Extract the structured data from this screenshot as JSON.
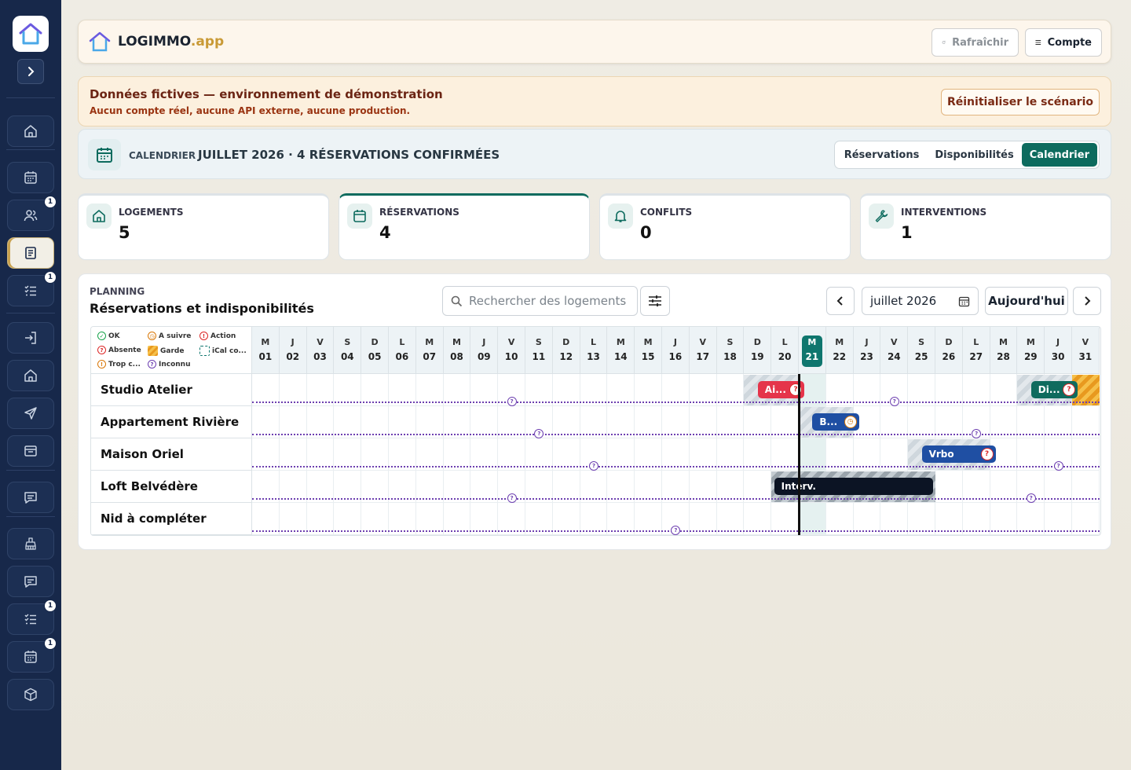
{
  "brand": {
    "name": "LOGIMMO",
    "suffix": ".app"
  },
  "topbar": {
    "refresh_label": "Rafraîchir",
    "account_label": "Compte"
  },
  "banner": {
    "title": "Données fictives — environnement de démonstration",
    "subtitle": "Aucun compte réel, aucune API externe, aucune production.",
    "reset_label": "Réinitialiser le scénario"
  },
  "calendar_bar": {
    "label": "CALENDRIER",
    "title": "JUILLET 2026 · 4 RÉSERVATIONS CONFIRMÉES",
    "tabs": [
      {
        "label": "Réservations",
        "active": false
      },
      {
        "label": "Disponibilités",
        "active": false
      },
      {
        "label": "Calendrier",
        "active": true
      }
    ]
  },
  "kpis": [
    {
      "label": "LOGEMENTS",
      "value": "5",
      "icon": "home-icon"
    },
    {
      "label": "RÉSERVATIONS",
      "value": "4",
      "icon": "calendar-icon"
    },
    {
      "label": "CONFLITS",
      "value": "0",
      "icon": "bell-icon"
    },
    {
      "label": "INTERVENTIONS",
      "value": "1",
      "icon": "wrench-icon"
    }
  ],
  "sidebar": {
    "items": [
      {
        "icon": "home-icon",
        "badge": ""
      },
      {
        "icon": "calendar-icon",
        "badge": ""
      },
      {
        "icon": "users-icon",
        "badge": "1"
      },
      {
        "icon": "document-icon",
        "badge": "",
        "active": true
      },
      {
        "icon": "checklist-icon",
        "badge": "1"
      },
      {
        "icon": "login-icon",
        "badge": ""
      },
      {
        "icon": "home-icon",
        "badge": ""
      },
      {
        "icon": "send-icon",
        "badge": ""
      },
      {
        "icon": "inbox-icon",
        "badge": ""
      },
      {
        "icon": "message-icon",
        "badge": ""
      },
      {
        "icon": "cleaning-icon",
        "badge": ""
      },
      {
        "icon": "chat-icon",
        "badge": ""
      },
      {
        "icon": "checklist-icon",
        "badge": "1"
      },
      {
        "icon": "calendar-icon",
        "badge": "1"
      },
      {
        "icon": "box-icon",
        "badge": ""
      }
    ]
  },
  "planning": {
    "label": "PLANNING",
    "title": "Réservations et indisponibilités",
    "search_placeholder": "Rechercher des logements",
    "month_value": "juillet 2026",
    "today_label": "Aujourd'hui",
    "legend": [
      {
        "label": "OK",
        "kind": "ok"
      },
      {
        "label": "A suivre",
        "kind": "follow"
      },
      {
        "label": "Action",
        "kind": "action"
      },
      {
        "label": "Absente",
        "kind": "absent"
      },
      {
        "label": "Garde",
        "kind": "garde"
      },
      {
        "label": "iCal co...",
        "kind": "ical"
      },
      {
        "label": "Trop c...",
        "kind": "trop"
      },
      {
        "label": "Inconnu",
        "kind": "unknown"
      }
    ],
    "today_index": 20,
    "days": [
      {
        "l": "M",
        "n": "01"
      },
      {
        "l": "J",
        "n": "02"
      },
      {
        "l": "V",
        "n": "03"
      },
      {
        "l": "S",
        "n": "04"
      },
      {
        "l": "D",
        "n": "05"
      },
      {
        "l": "L",
        "n": "06"
      },
      {
        "l": "M",
        "n": "07"
      },
      {
        "l": "M",
        "n": "08"
      },
      {
        "l": "J",
        "n": "09"
      },
      {
        "l": "V",
        "n": "10"
      },
      {
        "l": "S",
        "n": "11"
      },
      {
        "l": "D",
        "n": "12"
      },
      {
        "l": "L",
        "n": "13"
      },
      {
        "l": "M",
        "n": "14"
      },
      {
        "l": "M",
        "n": "15"
      },
      {
        "l": "J",
        "n": "16"
      },
      {
        "l": "V",
        "n": "17"
      },
      {
        "l": "S",
        "n": "18"
      },
      {
        "l": "D",
        "n": "19"
      },
      {
        "l": "L",
        "n": "20"
      },
      {
        "l": "M",
        "n": "21"
      },
      {
        "l": "M",
        "n": "22"
      },
      {
        "l": "J",
        "n": "23"
      },
      {
        "l": "V",
        "n": "24"
      },
      {
        "l": "S",
        "n": "25"
      },
      {
        "l": "D",
        "n": "26"
      },
      {
        "l": "L",
        "n": "27"
      },
      {
        "l": "M",
        "n": "28"
      },
      {
        "l": "M",
        "n": "29"
      },
      {
        "l": "J",
        "n": "30"
      },
      {
        "l": "V",
        "n": "31"
      }
    ],
    "rows": [
      {
        "name": "Studio Atelier",
        "unknown_day": 10,
        "blocks": [
          {
            "kind": "hatch",
            "start": 19,
            "end": 20
          },
          {
            "kind": "hatch",
            "start": 29,
            "end": 30
          },
          {
            "kind": "garde",
            "start": 31,
            "end": 31
          }
        ],
        "bookings": [
          {
            "label": "Ai...",
            "start": 19.5,
            "end": 21.2,
            "color": "#e5344a",
            "status": "action"
          },
          {
            "label": "Di...",
            "start": 29.5,
            "end": 31.2,
            "color": "#0f6b5e",
            "status": "action"
          }
        ]
      },
      {
        "name": "Appartement Rivière",
        "unknown_day": 11,
        "blocks": [
          {
            "kind": "hatch",
            "start": 21,
            "end": 22
          }
        ],
        "bookings": [
          {
            "label": "B...",
            "start": 21.5,
            "end": 23.2,
            "color": "#1f4fa3",
            "status": "follow"
          }
        ]
      },
      {
        "name": "Maison Oriel",
        "unknown_day": 13,
        "blocks": [
          {
            "kind": "hatch",
            "start": 25,
            "end": 27
          }
        ],
        "bookings": [
          {
            "label": "Vrbo",
            "start": 25.5,
            "end": 28.2,
            "color": "#1f4fa3",
            "status": "action"
          }
        ]
      },
      {
        "name": "Loft Belvédère",
        "unknown_day": 10,
        "blocks": [
          {
            "kind": "hatchdark",
            "start": 20,
            "end": 25
          }
        ],
        "bookings": [
          {
            "label": "Interv.",
            "start": 20.1,
            "end": 25.9,
            "color": "#0c1424",
            "status": ""
          }
        ]
      },
      {
        "name": "Nid à compléter",
        "unknown_day": 16,
        "blocks": [],
        "bookings": []
      }
    ],
    "right_unknowns": [
      {
        "row": 0,
        "day": 24
      },
      {
        "row": 1,
        "day": 27
      },
      {
        "row": 2,
        "day": 30
      },
      {
        "row": 3,
        "day": 29
      }
    ]
  }
}
